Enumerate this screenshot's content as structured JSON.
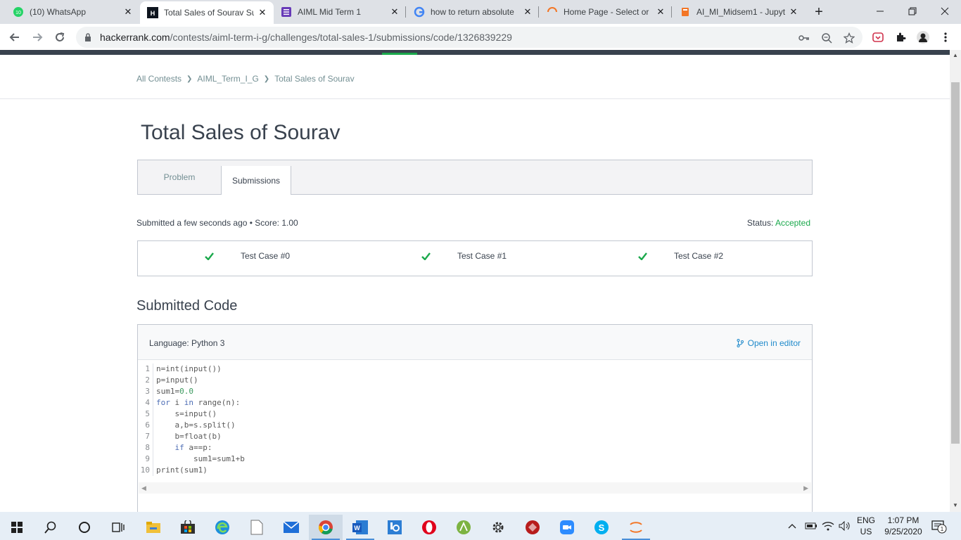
{
  "browser": {
    "tabs": [
      {
        "label": "(10) WhatsApp",
        "icon": "whatsapp-icon"
      },
      {
        "label": "Total Sales of Sourav Su",
        "icon": "hackerrank-icon",
        "active": true
      },
      {
        "label": "AIML Mid Term 1",
        "icon": "forms-icon"
      },
      {
        "label": "how to return absolute",
        "icon": "google-icon"
      },
      {
        "label": "Home Page - Select or",
        "icon": "loading-icon"
      },
      {
        "label": "AI_MI_Midsem1 - Jupyt",
        "icon": "jupyter-icon"
      }
    ],
    "url_host": "hackerrank.com",
    "url_path": "/contests/aiml-term-i-g/challenges/total-sales-1/submissions/code/1326839229"
  },
  "breadcrumbs": [
    "All Contests",
    "AIML_Term_I_G",
    "Total Sales of Sourav"
  ],
  "page": {
    "title": "Total Sales of Sourav",
    "tabs": [
      "Problem",
      "Submissions"
    ],
    "active_tab": "Submissions",
    "submission_info": "Submitted a few seconds ago • Score: 1.00",
    "status_label": "Status:",
    "status_value": "Accepted",
    "test_cases": [
      "Test Case #0",
      "Test Case #1",
      "Test Case #2"
    ],
    "code_heading": "Submitted Code",
    "language": "Language: Python 3",
    "open_in_editor": "Open in editor",
    "code_lines": [
      "n=int(input())",
      "p=input()",
      "sum1=0.0",
      "for i in range(n):",
      "    s=input()",
      "    a,b=s.split()",
      "    b=float(b)",
      "    if a==p:",
      "        sum1=sum1+b",
      "print(sum1)"
    ]
  },
  "taskbar": {
    "language": "ENG",
    "region": "US",
    "time": "1:07 PM",
    "date": "9/25/2020",
    "notifications": "1"
  },
  "colors": {
    "accepted_green": "#1ba94c",
    "link_blue": "#1f8acb",
    "header_dark": "#39424e"
  }
}
